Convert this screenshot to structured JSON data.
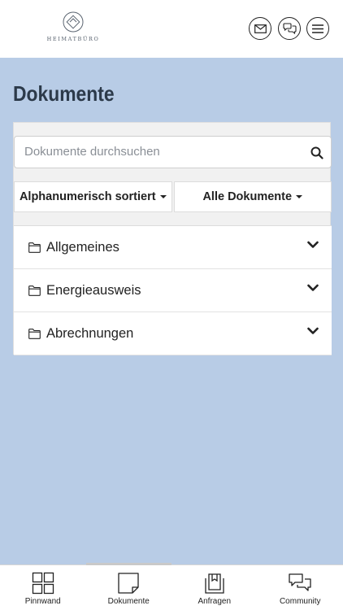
{
  "header": {
    "logo_text": "HEIMATBÜRO",
    "buttons": [
      {
        "name": "mail-button",
        "icon": "mail-icon"
      },
      {
        "name": "chat-button",
        "icon": "chat-bubbles-icon"
      },
      {
        "name": "menu-button",
        "icon": "hamburger-menu-icon"
      }
    ]
  },
  "page": {
    "title": "Dokumente"
  },
  "search": {
    "placeholder": "Dokumente durchsuchen",
    "icon": "search-icon"
  },
  "filters": {
    "sort_label": "Alphanumerisch sortiert",
    "filter_label": "Alle Dokumente"
  },
  "folders": [
    {
      "label": "Allgemeines",
      "icon": "folder-icon"
    },
    {
      "label": "Energieausweis",
      "icon": "folder-icon"
    },
    {
      "label": "Abrechnungen",
      "icon": "folder-icon"
    }
  ],
  "tabs": [
    {
      "label": "Pinnwand",
      "icon": "grid-icon",
      "active": false
    },
    {
      "label": "Dokumente",
      "icon": "document-icon",
      "active": true
    },
    {
      "label": "Anfragen",
      "icon": "inbox-icon",
      "active": false
    },
    {
      "label": "Community",
      "icon": "chat-bubbles-icon",
      "active": false
    }
  ],
  "colors": {
    "background": "#b8cce6",
    "title": "#2c3a4a"
  }
}
